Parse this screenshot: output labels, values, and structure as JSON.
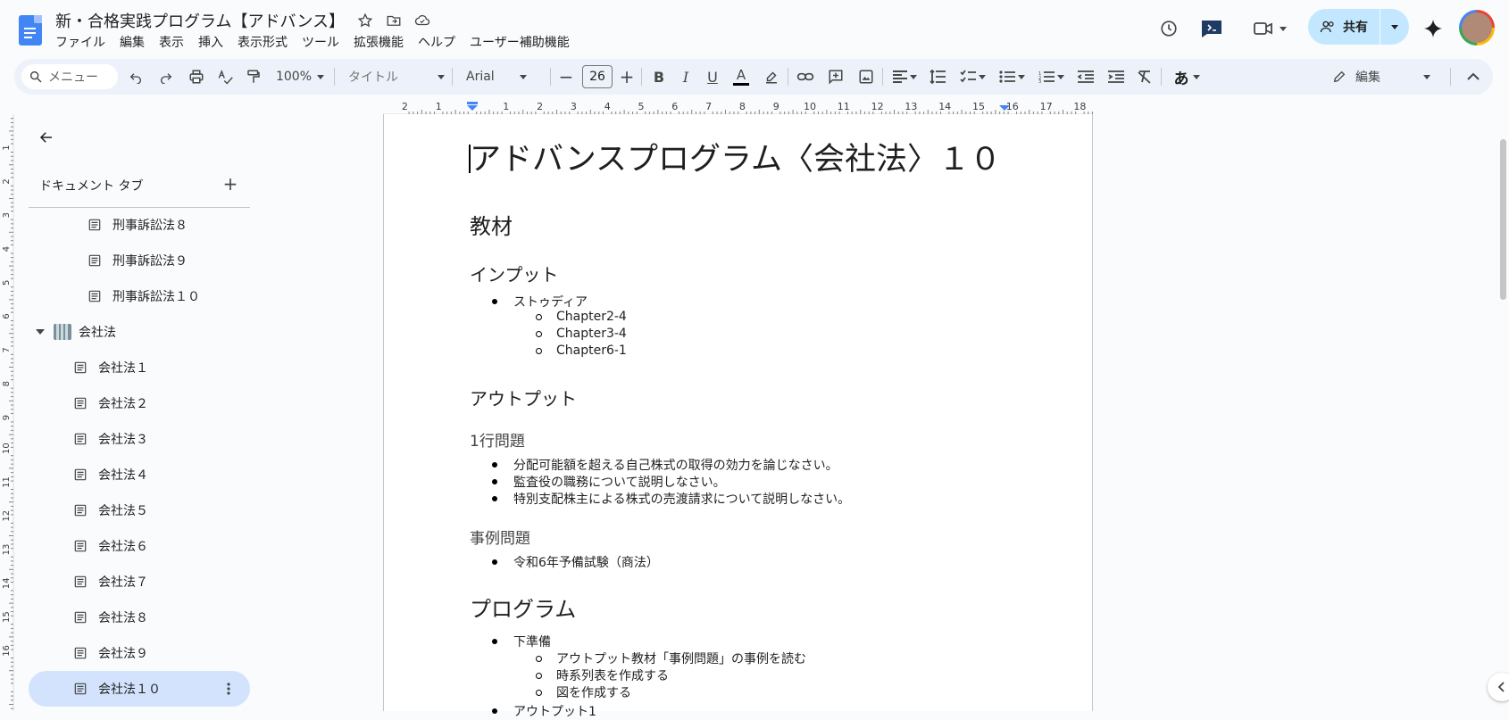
{
  "app": {
    "doc_title": "新・合格実践プログラム【アドバンス】",
    "menu": [
      "ファイル",
      "編集",
      "表示",
      "挿入",
      "表示形式",
      "ツール",
      "拡張機能",
      "ヘルプ",
      "ユーザー補助機能"
    ],
    "share_label": "共有"
  },
  "toolbar": {
    "search_placeholder": "メニュー",
    "zoom": "100%",
    "style": "タイトル",
    "font": "Arial",
    "font_size": "26",
    "input_tool": "あ",
    "mode": "編集"
  },
  "ruler": {
    "labels": [
      "2",
      "1",
      "",
      "1",
      "2",
      "3",
      "4",
      "5",
      "6",
      "7",
      "8",
      "9",
      "10",
      "11",
      "12",
      "13",
      "14",
      "15",
      "16",
      "17",
      "18"
    ]
  },
  "left_ruler": {
    "labels": [
      "1",
      "2",
      "3",
      "4",
      "5",
      "6",
      "7",
      "8",
      "9",
      "10",
      "11",
      "12",
      "13",
      "14",
      "15",
      "16"
    ]
  },
  "sidebar": {
    "header": "ドキュメント タブ",
    "sub_items_top": [
      "刑事訴訟法８",
      "刑事訴訟法９",
      "刑事訴訟法１０"
    ],
    "group": "会社法",
    "items": [
      "会社法１",
      "会社法２",
      "会社法３",
      "会社法４",
      "会社法５",
      "会社法６",
      "会社法７",
      "会社法８",
      "会社法９",
      "会社法１０"
    ]
  },
  "document": {
    "title": "アドバンスプログラム〈会社法〉１０",
    "h_materials": "教材",
    "h_input": "インプット",
    "input_item": "ストゥディア",
    "input_subs": [
      "Chapter2-4",
      "Chapter3-4",
      "Chapter6-1"
    ],
    "h_output": "アウトプット",
    "h_one_line": "1行問題",
    "one_line_items": [
      "分配可能額を超える自己株式の取得の効力を論じなさい。",
      "監査役の職務について説明しなさい。",
      "特別支配株主による株式の売渡請求について説明しなさい。"
    ],
    "h_case": "事例問題",
    "case_items": [
      "令和6年予備試験（商法）"
    ],
    "h_program": "プログラム",
    "prep": "下準備",
    "prep_subs": [
      "アウトプット教材「事例問題」の事例を読む",
      "時系列表を作成する",
      "図を作成する"
    ],
    "output1": "アウトプット1"
  }
}
